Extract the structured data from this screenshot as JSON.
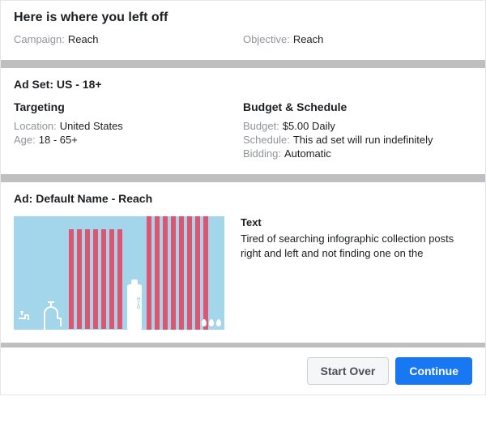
{
  "header": {
    "title": "Here is where you left off",
    "campaign_label": "Campaign:",
    "campaign_value": "Reach",
    "objective_label": "Objective:",
    "objective_value": "Reach"
  },
  "adset": {
    "title_label": "Ad Set:",
    "title_value": "US - 18+",
    "targeting_head": "Targeting",
    "location_label": "Location:",
    "location_value": "United States",
    "age_label": "Age:",
    "age_value": "18 - 65+",
    "budget_head": "Budget & Schedule",
    "budget_label": "Budget:",
    "budget_value": "$5.00 Daily",
    "schedule_label": "Schedule:",
    "schedule_value": "This ad set will run indefinitely",
    "bidding_label": "Bidding:",
    "bidding_value": "Automatic"
  },
  "ad": {
    "title_label": "Ad:",
    "title_value": "Default Name - Reach",
    "text_head": "Text",
    "body": "Tired of searching infographic collection posts right and left and not finding one on the",
    "h2o": "H2O"
  },
  "footer": {
    "start_over": "Start Over",
    "continue": "Continue"
  }
}
